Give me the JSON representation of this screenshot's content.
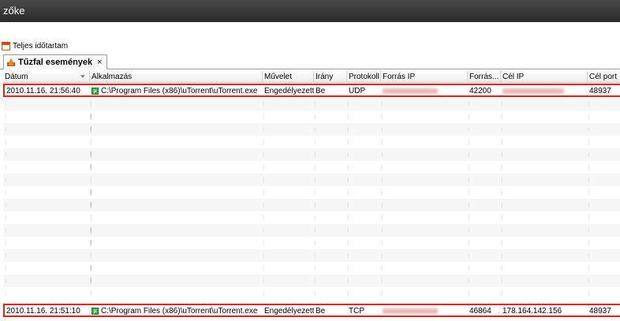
{
  "window": {
    "title": "zőke"
  },
  "toolbar": {
    "period_label": "Teljes időtartam"
  },
  "tab": {
    "label": "Tűzfal események",
    "close": "×"
  },
  "columns": [
    "Dátum",
    "Alkalmazás",
    "Művelet",
    "Irány",
    "Protokoll",
    "Forrás IP",
    "Forrás...",
    "Cél IP",
    "Cél port"
  ],
  "top_row": {
    "date": "2010.11.16. 21:56:40",
    "app": "C:\\Program Files (x86)\\uTorrent\\uTorrent.exe",
    "action": "Engedélyezett",
    "direction": "Be",
    "protocol": "UDP",
    "src_port": "42200",
    "dst_port": "48937"
  },
  "bottom_row": {
    "date": "2010.11.16. 21:51:10",
    "app": "C:\\Program Files (x86)\\uTorrent\\uTorrent.exe",
    "action": "Engedélyezett",
    "direction": "Be",
    "protocol": "TCP",
    "src_port": "46864",
    "dst_ip": "178.164.142.156",
    "dst_port": "48937"
  },
  "highlight_color": "#e0201a"
}
